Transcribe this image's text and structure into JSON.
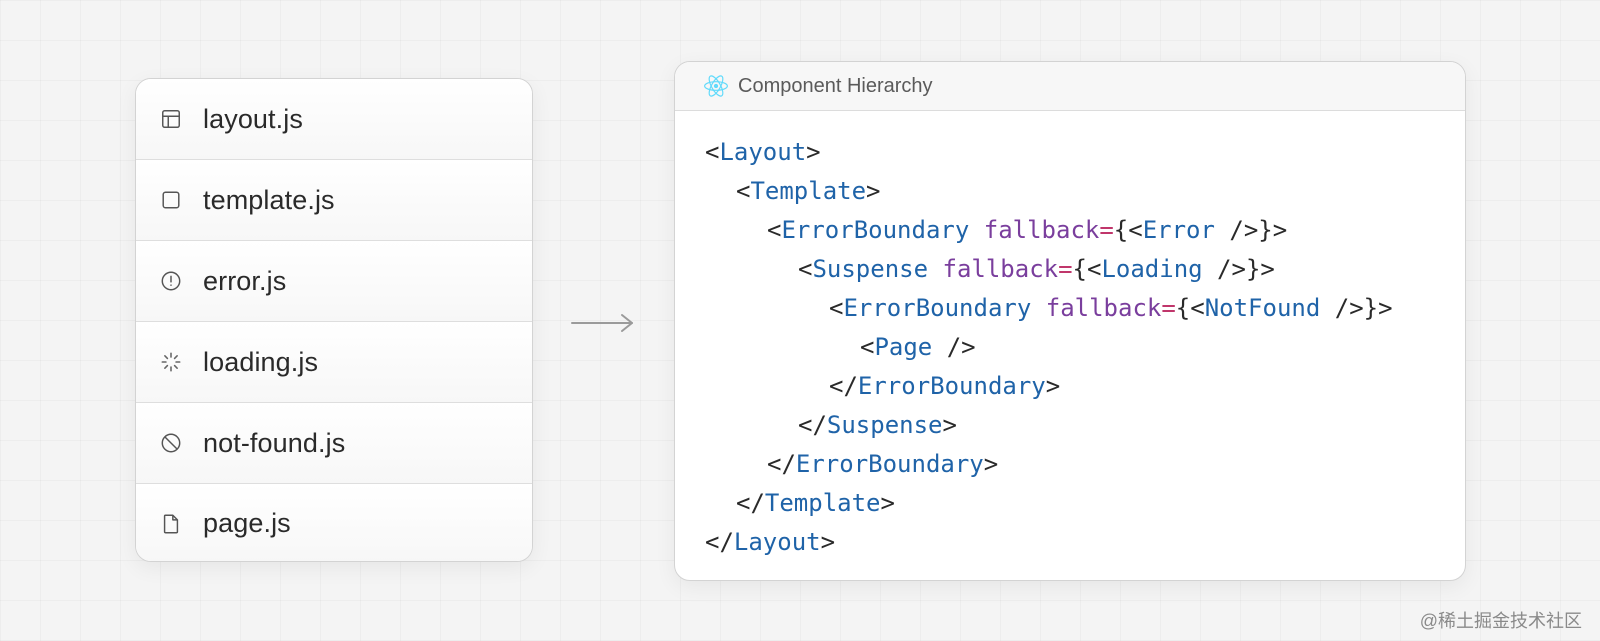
{
  "files": [
    {
      "name": "layout.js",
      "icon": "layout-icon"
    },
    {
      "name": "template.js",
      "icon": "square-icon"
    },
    {
      "name": "error.js",
      "icon": "alert-circle-icon"
    },
    {
      "name": "loading.js",
      "icon": "loader-icon"
    },
    {
      "name": "not-found.js",
      "icon": "ban-icon"
    },
    {
      "name": "page.js",
      "icon": "file-icon"
    }
  ],
  "arrow_icon": "arrow-right-icon",
  "code_panel": {
    "icon": "react-icon",
    "title": "Component Hierarchy",
    "lines": [
      {
        "indent": 0,
        "tokens": [
          {
            "t": "<",
            "k": "punct"
          },
          {
            "t": "Layout",
            "k": "tag"
          },
          {
            "t": ">",
            "k": "punct"
          }
        ]
      },
      {
        "indent": 1,
        "tokens": [
          {
            "t": "<",
            "k": "punct"
          },
          {
            "t": "Template",
            "k": "tag"
          },
          {
            "t": ">",
            "k": "punct"
          }
        ]
      },
      {
        "indent": 2,
        "tokens": [
          {
            "t": "<",
            "k": "punct"
          },
          {
            "t": "ErrorBoundary",
            "k": "tag"
          },
          {
            "t": " ",
            "k": "punct"
          },
          {
            "t": "fallback",
            "k": "attr"
          },
          {
            "t": "=",
            "k": "eq"
          },
          {
            "t": "{<",
            "k": "punct"
          },
          {
            "t": "Error",
            "k": "tag"
          },
          {
            "t": " />}>",
            "k": "punct"
          }
        ]
      },
      {
        "indent": 3,
        "tokens": [
          {
            "t": "<",
            "k": "punct"
          },
          {
            "t": "Suspense",
            "k": "tag"
          },
          {
            "t": " ",
            "k": "punct"
          },
          {
            "t": "fallback",
            "k": "attr"
          },
          {
            "t": "=",
            "k": "eq"
          },
          {
            "t": "{<",
            "k": "punct"
          },
          {
            "t": "Loading",
            "k": "tag"
          },
          {
            "t": " />}>",
            "k": "punct"
          }
        ]
      },
      {
        "indent": 4,
        "tokens": [
          {
            "t": "<",
            "k": "punct"
          },
          {
            "t": "ErrorBoundary",
            "k": "tag"
          },
          {
            "t": " ",
            "k": "punct"
          },
          {
            "t": "fallback",
            "k": "attr"
          },
          {
            "t": "=",
            "k": "eq"
          },
          {
            "t": "{<",
            "k": "punct"
          },
          {
            "t": "NotFound",
            "k": "tag"
          },
          {
            "t": " />}>",
            "k": "punct"
          }
        ]
      },
      {
        "indent": 5,
        "tokens": [
          {
            "t": "<",
            "k": "punct"
          },
          {
            "t": "Page",
            "k": "tag"
          },
          {
            "t": " />",
            "k": "punct"
          }
        ]
      },
      {
        "indent": 4,
        "tokens": [
          {
            "t": "</",
            "k": "punct"
          },
          {
            "t": "ErrorBoundary",
            "k": "tag"
          },
          {
            "t": ">",
            "k": "punct"
          }
        ]
      },
      {
        "indent": 3,
        "tokens": [
          {
            "t": "</",
            "k": "punct"
          },
          {
            "t": "Suspense",
            "k": "tag"
          },
          {
            "t": ">",
            "k": "punct"
          }
        ]
      },
      {
        "indent": 2,
        "tokens": [
          {
            "t": "</",
            "k": "punct"
          },
          {
            "t": "ErrorBoundary",
            "k": "tag"
          },
          {
            "t": ">",
            "k": "punct"
          }
        ]
      },
      {
        "indent": 1,
        "tokens": [
          {
            "t": "</",
            "k": "punct"
          },
          {
            "t": "Template",
            "k": "tag"
          },
          {
            "t": ">",
            "k": "punct"
          }
        ]
      },
      {
        "indent": 0,
        "tokens": [
          {
            "t": "</",
            "k": "punct"
          },
          {
            "t": "Layout",
            "k": "tag"
          },
          {
            "t": ">",
            "k": "punct"
          }
        ]
      }
    ]
  },
  "colors": {
    "tag": "#1f63a8",
    "attribute": "#7a3e9d",
    "equals": "#c0366b",
    "react_icon": "#61dafb"
  },
  "watermark": "@稀土掘金技术社区"
}
